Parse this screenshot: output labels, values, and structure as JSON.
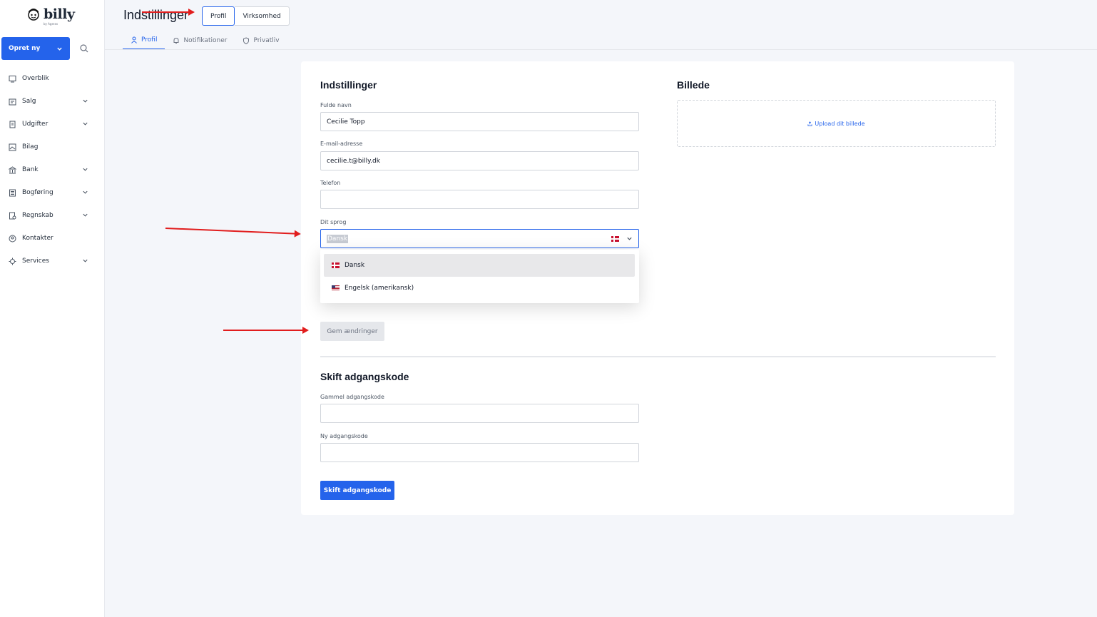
{
  "brand": {
    "name": "billy",
    "sub": "by Ageras"
  },
  "sidebar": {
    "create_label": "Opret ny",
    "items": [
      {
        "label": "Overblik",
        "icon": "overview-icon",
        "has_chevron": false
      },
      {
        "label": "Salg",
        "icon": "sales-icon",
        "has_chevron": true
      },
      {
        "label": "Udgifter",
        "icon": "expenses-icon",
        "has_chevron": true
      },
      {
        "label": "Bilag",
        "icon": "attachments-icon",
        "has_chevron": false
      },
      {
        "label": "Bank",
        "icon": "bank-icon",
        "has_chevron": true
      },
      {
        "label": "Bogføring",
        "icon": "bookkeeping-icon",
        "has_chevron": true
      },
      {
        "label": "Regnskab",
        "icon": "accounting-icon",
        "has_chevron": true
      },
      {
        "label": "Kontakter",
        "icon": "contacts-icon",
        "has_chevron": false
      },
      {
        "label": "Services",
        "icon": "services-icon",
        "has_chevron": true
      }
    ]
  },
  "header": {
    "title": "Indstillinger",
    "segments": [
      "Profil",
      "Virksomhed"
    ],
    "active_segment": "Profil",
    "subtabs": [
      {
        "label": "Profil",
        "icon": "user-icon"
      },
      {
        "label": "Notifikationer",
        "icon": "bell-icon"
      },
      {
        "label": "Privatliv",
        "icon": "shield-icon"
      }
    ],
    "active_subtab": "Profil"
  },
  "settings": {
    "heading": "Indstillinger",
    "full_name_label": "Fulde navn",
    "full_name_value": "Cecilie Topp",
    "email_label": "E-mail-adresse",
    "email_value": "cecilie.t@billy.dk",
    "phone_label": "Telefon",
    "phone_value": "",
    "language_label": "Dit sprog",
    "language_value": "Dansk",
    "language_options": [
      {
        "label": "Dansk",
        "flag": "denmark-flag-icon"
      },
      {
        "label": "Engelsk (amerikansk)",
        "flag": "us-flag-icon"
      }
    ],
    "save_label": "Gem ændringer"
  },
  "picture": {
    "heading": "Billede",
    "upload_label": "Upload dit billede"
  },
  "password": {
    "heading": "Skift adgangskode",
    "old_label": "Gammel adgangskode",
    "new_label": "Ny adgangskode",
    "submit_label": "Skift adgangskode"
  },
  "colors": {
    "accent": "#2463eb",
    "annotation": "#e11d1d",
    "background": "#f4f6fa"
  }
}
